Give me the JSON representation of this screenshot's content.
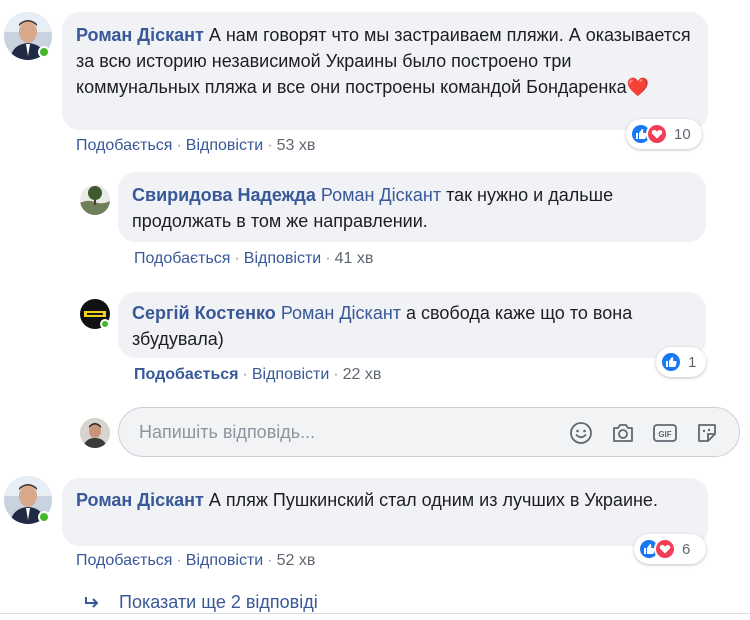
{
  "comments": [
    {
      "author": "Роман Діскант",
      "text": "А нам говорят что мы застраиваем пляжи. А оказывается за всю историю независимой Украины было построено три коммунальных пляжа и все они построены командой Бондаренка",
      "emoji": "❤️",
      "like_label": "Подобається",
      "reply_label": "Відповісти",
      "time": "53 хв",
      "reaction_count": "10"
    },
    {
      "author": "Свиридова Надежда",
      "mention": "Роман Діскант",
      "text": "так нужно и дальше продолжать в том же направлении.",
      "like_label": "Подобається",
      "reply_label": "Відповісти",
      "time": "41 хв"
    },
    {
      "author": "Сергій Костенко",
      "mention": "Роман Діскант",
      "text": "а свобода каже що то вона збудувала)",
      "like_label": "Подобається",
      "reply_label": "Відповісти",
      "time": "22 хв",
      "reaction_count": "1"
    },
    {
      "author": "Роман Діскант",
      "text": "А пляж Пушкинский стал одним из лучших в Украине.",
      "like_label": "Подобається",
      "reply_label": "Відповісти",
      "time": "52 хв",
      "reaction_count": "6"
    }
  ],
  "reply_box": {
    "placeholder": "Напишіть відповідь...",
    "tools": [
      "emoji-icon",
      "camera-icon",
      "gif-icon",
      "sticker-icon"
    ]
  },
  "show_more": "Показати ще 2 відповіді",
  "colors": {
    "link": "#385898",
    "bubble": "#f0f2f5",
    "like": "#1877f2",
    "love": "#f33e58",
    "online": "#42b72a"
  }
}
